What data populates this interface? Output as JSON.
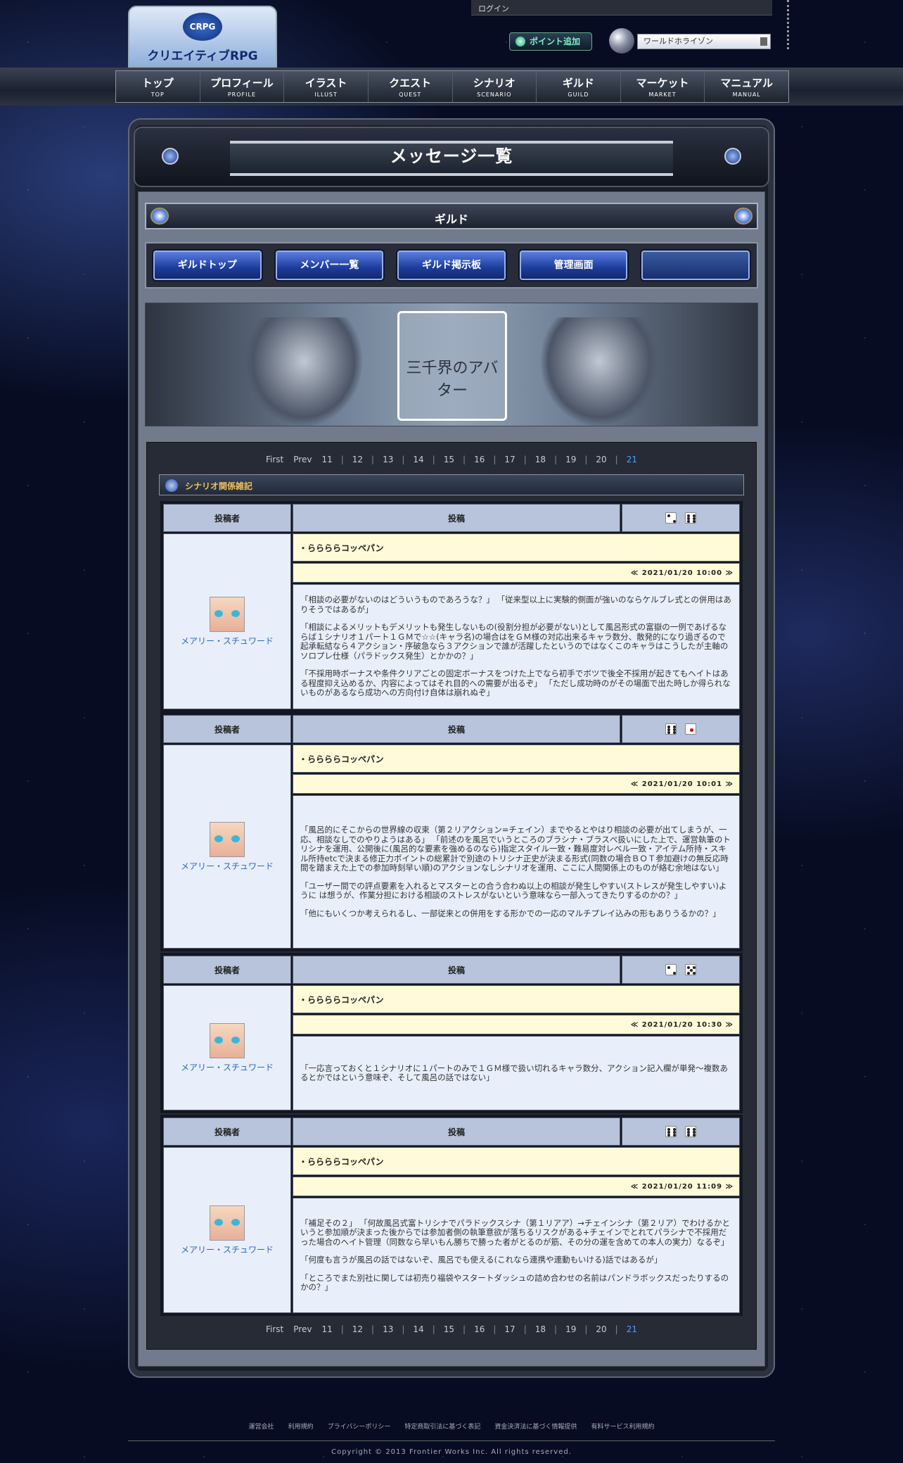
{
  "header": {
    "login": "ログイン",
    "logo_mark": "CRPG",
    "logo_text": "クリエイティブRPG",
    "point_button": "ポイント追加",
    "world_select": "ワールドホライゾン"
  },
  "nav": [
    {
      "jp": "トップ",
      "en": "TOP"
    },
    {
      "jp": "プロフィール",
      "en": "PROFILE"
    },
    {
      "jp": "イラスト",
      "en": "ILLUST"
    },
    {
      "jp": "クエスト",
      "en": "QUEST"
    },
    {
      "jp": "シナリオ",
      "en": "SCENARIO"
    },
    {
      "jp": "ギルド",
      "en": "GUILD"
    },
    {
      "jp": "マーケット",
      "en": "MARKET"
    },
    {
      "jp": "マニュアル",
      "en": "MANUAL"
    }
  ],
  "page_title": "メッセージ一覧",
  "guild_title": "ギルド",
  "guild_menu": [
    "ギルドトップ",
    "メンバー一覧",
    "ギルド掲示板",
    "管理画面",
    ""
  ],
  "banner_logo": "三千界のアバター",
  "pager": {
    "first": "First",
    "prev": "Prev",
    "pages": [
      "11",
      "12",
      "13",
      "14",
      "15",
      "16",
      "17",
      "18",
      "19",
      "20",
      "21"
    ],
    "current": "21"
  },
  "thread_title": "シナリオ関係雑記",
  "columns": {
    "author": "投稿者",
    "post": "投稿"
  },
  "posts": [
    {
      "author": "メアリー・スチュワード",
      "subject": "・ららららコッペパン",
      "date": "≪ 2021/01/20 10:00 ≫",
      "dice": [
        2,
        6
      ],
      "paragraphs": [
        "「相談の必要がないのはどういうものであろうな？」\n「従来型以上に実験的側面が強いのならケルブレ式との併用はありそうではあるが」",
        "「相談によるメリットもデメリットも発生しないもの(役割分担が必要がない)として風呂形式の富嶽の一例であげるならば１シナリオ１パート１ＧＭで☆☆(キャラ名)の場合はをＧＭ様の対応出来るキャラ数分、散発的になり過ぎるので起承転結なら４アクション・序破急なら３アクションで誰が活躍したというのではなくこのキャラはこうしたが主軸のソロプレ仕様（パラドックス発生）とかかの？」",
        "「不採用時ボーナスや条件クリアごとの固定ボーナスをつけた上でなら初手でボツで後全不採用が起きてもヘイトはある程度抑え込めるか、内容によってはそれ目的への需要が出るぞ」\n「ただし成功時のがその場面で出た時しか得られないものがあるなら成功への方向付け自体は崩れぬぞ」"
      ]
    },
    {
      "author": "メアリー・スチュワード",
      "subject": "・ららららコッペパン",
      "date": "≪ 2021/01/20 10:01 ≫",
      "dice": [
        6,
        1
      ],
      "paragraphs": [
        "「風呂的にそこからの世界線の収束（第２リアクション=チェイン）までやるとやはり相談の必要が出てしまうが、一応、相談なしでのやりようはある」\n「前述のを風呂でいうところのブラシナ・ブラスぺ扱いにした上で、運営執筆のトリシナを運用、公開後に(風呂的な要素を強めるのなら)指定スタイル一致・難易度対レベル一致・アイテム所持・スキル所持etcで決まる修正力ポイントの総累計で別途のトリシナ正史が決まる形式(同数の場合ＢＯＴ参加避けの無反応時間を踏まえた上での参加時刻早い順)のアクションなしシナリオを運用、ここに人間関係上のものが絡む余地はない」",
        "「ユーザー間での評点要素を入れるとマスターとの合う合わぬ以上の相談が発生しやすい(ストレスが発生しやすい)ように は想うが、作業分担における相談のストレスがないという意味なら一部入ってきたりするのかの？」",
        "「他にもいくつか考えられるし、一部従来との併用をする形かでの一応のマルチプレイ込みの形もありうるかの？」"
      ]
    },
    {
      "author": "メアリー・スチュワード",
      "subject": "・ららららコッペパン",
      "date": "≪ 2021/01/20 10:30 ≫",
      "dice": [
        2,
        5
      ],
      "paragraphs": [
        "「一応言っておくと１シナリオに１パートのみで１ＧＭ様で扱い切れるキャラ数分、アクション記入欄が単発〜複数あるとかではという意味ぞ、そして風呂の話ではない」"
      ]
    },
    {
      "author": "メアリー・スチュワード",
      "subject": "・ららららコッペパン",
      "date": "≪ 2021/01/20 11:09 ≫",
      "dice": [
        6,
        6
      ],
      "paragraphs": [
        "「補足その２」\n「何故風呂式富トリシナでパラドックスシナ（第１リアア）→チェインシナ（第２リア）でわけるかというと参加順が決まった後からでは参加者側の執筆意欲が落ちるリスクがある+チェインでとれてパラシナで不採用だった場合のヘイト管理（同数なら早いもん勝ちで勝った者がとるのが筋、その分の運を含めての本人の実力）なるぞ」",
        "「何度も言うが風呂の話ではないぞ、風呂でも使える(これなら連携や連動もいける)話ではあるが」",
        "「ところでまた別社に関しては初売り福袋やスタートダッシュの詰め合わせの名前はパンドラボックスだったりするのかの？」"
      ]
    }
  ],
  "footer": {
    "links": [
      "運営会社",
      "利用規約",
      "プライバシーポリシー",
      "特定商取引法に基づく表記",
      "資金決済法に基づく情報提供",
      "有料サービス利用規約"
    ],
    "copyright": "Copyright © 2013 Frontier Works Inc. All rights reserved."
  }
}
